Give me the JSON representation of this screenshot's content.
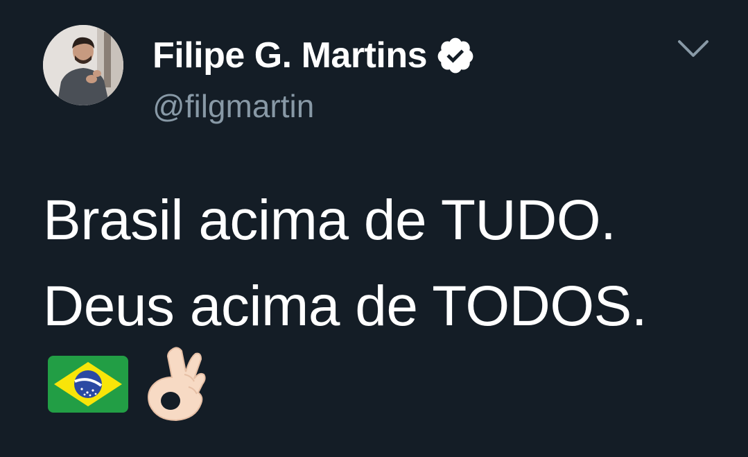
{
  "tweet": {
    "author": {
      "display_name": "Filipe G. Martins",
      "handle": "@filgmartin",
      "verified_icon": "verified-badge-icon",
      "avatar_icon": "avatar-photo"
    },
    "menu_icon": "chevron-down-icon",
    "text_lines": [
      "Brasil acima de TUDO.",
      "Deus acima de TODOS."
    ],
    "emojis": [
      "brazil-flag-emoji",
      "ok-hand-emoji"
    ]
  },
  "colors": {
    "background": "#141d26",
    "text_primary": "#ffffff",
    "text_secondary": "#8899a6",
    "flag_green": "#229e45",
    "flag_yellow": "#f8e509",
    "flag_blue": "#2b49a3",
    "skin_tone": "#f7dac4"
  }
}
